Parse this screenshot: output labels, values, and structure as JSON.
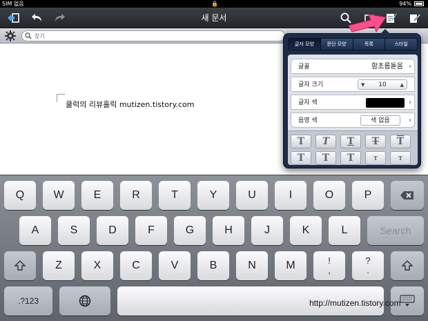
{
  "status_bar": {
    "carrier": "SIM 없음",
    "battery": "94%"
  },
  "toolbar": {
    "title": "새 문서"
  },
  "search": {
    "placeholder": "찾기"
  },
  "document": {
    "text": "쿨럭의 리뷰홀릭 mutizen.tistory.com"
  },
  "format_popover": {
    "tabs": [
      "글자 모양",
      "문단 모양",
      "목록",
      "스타일"
    ],
    "active_tab": "글자 모양",
    "font_label": "글꼴",
    "font_value": "함초롬돋움",
    "size_label": "글자 크기",
    "size_value": "10",
    "color_label": "글자 색",
    "color_value": "#000000",
    "shade_label": "음영 색",
    "shade_value": "색 없음",
    "style_buttons": [
      "T",
      "T",
      "T",
      "T",
      "T",
      "T",
      "T",
      "T",
      "T",
      "T"
    ]
  },
  "keyboard": {
    "row1": [
      "Q",
      "W",
      "E",
      "R",
      "T",
      "Y",
      "U",
      "I",
      "O",
      "P"
    ],
    "row2": [
      "A",
      "S",
      "D",
      "F",
      "G",
      "H",
      "J",
      "K",
      "L"
    ],
    "row2_action": "Search",
    "row3": [
      "Z",
      "X",
      "C",
      "V",
      "B",
      "N",
      "M"
    ],
    "row3_punct": [
      [
        "!",
        ","
      ],
      [
        "?",
        "."
      ]
    ],
    "numbers_key": ".?123",
    "watermark": "http://mutizen.tistory.com"
  },
  "colors": {
    "toolbar": "#2f3237",
    "popover": "#1c2d4a",
    "pointer": "#ff4f8b"
  },
  "icons": [
    "back-arrow-icon",
    "undo-icon",
    "redo-icon",
    "search-icon",
    "share-icon",
    "format-icon",
    "tools-icon",
    "gear-icon",
    "globe-icon",
    "shift-icon",
    "backspace-icon",
    "keyboard-hide-icon",
    "pointer-arrow-icon"
  ]
}
